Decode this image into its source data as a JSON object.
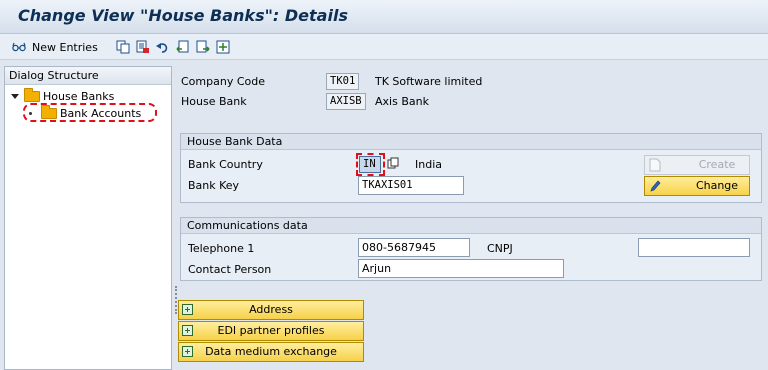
{
  "title": "Change View \"House Banks\": Details",
  "toolbar": {
    "new_entries": "New Entries"
  },
  "dialog": {
    "header": "Dialog Structure",
    "items": [
      {
        "label": "House Banks"
      },
      {
        "label": "Bank Accounts"
      }
    ]
  },
  "header_fields": {
    "company_code_label": "Company Code",
    "company_code_value": "TK01",
    "company_name": "TK Software limited",
    "house_bank_label": "House Bank",
    "house_bank_value": "AXISB",
    "house_bank_name": "Axis Bank"
  },
  "house_bank_data": {
    "title": "House Bank Data",
    "bank_country_label": "Bank Country",
    "bank_country_value": "IN",
    "country_name": "India",
    "bank_key_label": "Bank Key",
    "bank_key_value": "TKAXIS01",
    "create_label": "Create",
    "change_label": "Change"
  },
  "communications": {
    "title": "Communications data",
    "telephone_label": "Telephone 1",
    "telephone_value": "080-5687945",
    "cnpj_label": "CNPJ",
    "cnpj_value": "",
    "contact_label": "Contact Person",
    "contact_value": "Arjun"
  },
  "nav_buttons": {
    "address": "Address",
    "edi": "EDI partner profiles",
    "dme": "Data medium exchange"
  },
  "colors": {
    "highlight_red": "#e0101a",
    "button_yellow": "#f7d24a",
    "title_blue": "#0d2f55"
  }
}
